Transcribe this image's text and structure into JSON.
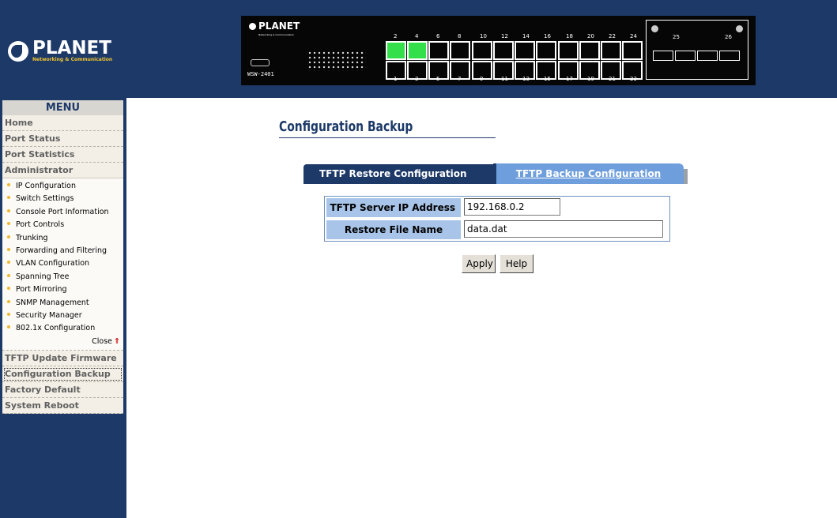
{
  "header": {
    "logo_name": "PLANET",
    "logo_tagline": "Networking & Communication",
    "panel": {
      "brand": "PLANET",
      "brand_sub": "Networking & Communication",
      "model": "WSW-2401",
      "top_port_numbers": [
        "2",
        "4",
        "6",
        "8",
        "10",
        "12",
        "14",
        "16",
        "18",
        "20",
        "22",
        "24"
      ],
      "bottom_port_numbers": [
        "1",
        "3",
        "5",
        "7",
        "9",
        "11",
        "13",
        "15",
        "17",
        "19",
        "21",
        "23"
      ],
      "active_ports": [
        "2",
        "4"
      ],
      "sfp_labels": [
        "25",
        "26"
      ]
    }
  },
  "sidebar": {
    "menu_title": "MENU",
    "items_top": [
      "Home",
      "Port Status",
      "Port Statistics",
      "Administrator"
    ],
    "submenu": [
      "IP Configuration",
      "Switch Settings",
      "Console Port Information",
      "Port Controls",
      "Trunking",
      "Forwarding and Filtering",
      "VLAN Configuration",
      "Spanning Tree",
      "Port Mirroring",
      "SNMP Management",
      "Security Manager",
      "802.1x Configuration"
    ],
    "close_label": "Close",
    "items_bottom": [
      "TFTP Update Firmware",
      "Configuration Backup",
      "Factory Default",
      "System Reboot"
    ]
  },
  "main": {
    "title": "Configuration Backup",
    "tabs": {
      "restore": "TFTP Restore Configuration",
      "backup": "TFTP Backup Configuration"
    },
    "form": {
      "ip_label": "TFTP Server IP Address",
      "ip_value": "192.168.0.2",
      "file_label": "Restore File Name",
      "file_value": "data.dat"
    },
    "buttons": {
      "apply": "Apply",
      "help": "Help"
    }
  },
  "colors": {
    "navy": "#1c3968",
    "tab_inactive": "#6e9edc",
    "label_bg": "#a8c4e8",
    "port_active": "#33e04b"
  }
}
